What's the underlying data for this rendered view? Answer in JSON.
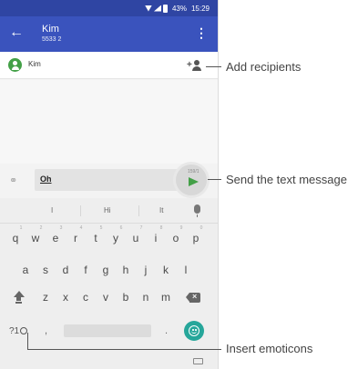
{
  "status_bar": {
    "battery": "43%",
    "time": "15:29"
  },
  "app_bar": {
    "back_icon": "arrow-left-icon",
    "contact_name": "Kim",
    "contact_number": "5533 2",
    "more_icon": "vertical-dots-icon"
  },
  "recipients": {
    "items": [
      {
        "name": "Kim"
      }
    ],
    "add_icon": "add-person-icon"
  },
  "compose": {
    "text": "Oh",
    "attach_icon": "paperclip-icon",
    "send_icon": "send-icon",
    "char_counter": "159/1"
  },
  "keyboard": {
    "suggestions": [
      "I",
      "Hi",
      "It"
    ],
    "row1": [
      {
        "key": "q",
        "hint": "1"
      },
      {
        "key": "w",
        "hint": "2"
      },
      {
        "key": "e",
        "hint": "3"
      },
      {
        "key": "r",
        "hint": "4"
      },
      {
        "key": "t",
        "hint": "5"
      },
      {
        "key": "y",
        "hint": "6"
      },
      {
        "key": "u",
        "hint": "7"
      },
      {
        "key": "i",
        "hint": "8"
      },
      {
        "key": "o",
        "hint": "9"
      },
      {
        "key": "p",
        "hint": "0"
      }
    ],
    "row2": [
      "a",
      "s",
      "d",
      "f",
      "g",
      "h",
      "j",
      "k",
      "l"
    ],
    "row3": [
      "z",
      "x",
      "c",
      "v",
      "b",
      "n",
      "m"
    ],
    "symbols_key": "?1",
    "comma": ",",
    "period": ".",
    "emoji_icon": "smiley-icon",
    "shift_icon": "shift-icon",
    "delete_icon": "backspace-icon"
  },
  "callouts": {
    "add_recipients": "Add recipients",
    "send_message": "Send the text message",
    "insert_emoticons": "Insert emoticons"
  },
  "colors": {
    "app_bar": "#3a53bd",
    "status_bar": "#2f45a3",
    "avatar": "#43a047",
    "send": "#43a047",
    "emoji_button": "#26a69a"
  }
}
